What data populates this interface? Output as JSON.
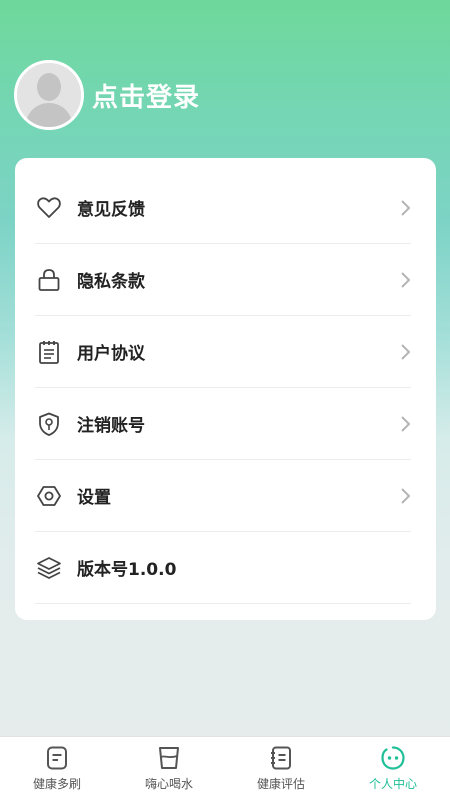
{
  "profile": {
    "login_text": "点击登录",
    "avatar_icon": "default-user-avatar"
  },
  "menu": [
    {
      "label": "意见反馈",
      "icon": "heart-icon",
      "has_arrow": true
    },
    {
      "label": "隐私条款",
      "icon": "lock-icon",
      "has_arrow": true
    },
    {
      "label": "用户协议",
      "icon": "notepad-icon",
      "has_arrow": true
    },
    {
      "label": "注销账号",
      "icon": "shield-key-icon",
      "has_arrow": true
    },
    {
      "label": "设置",
      "icon": "hexagon-settings-icon",
      "has_arrow": true
    },
    {
      "label": "版本号1.0.0",
      "icon": "layers-icon",
      "has_arrow": false
    }
  ],
  "tabs": [
    {
      "label": "健康多刷",
      "icon": "document-icon",
      "active": false
    },
    {
      "label": "嗨心喝水",
      "icon": "cup-icon",
      "active": false
    },
    {
      "label": "健康评估",
      "icon": "notebook-icon",
      "active": false
    },
    {
      "label": "个人中心",
      "icon": "smiley-icon",
      "active": true
    }
  ],
  "colors": {
    "accent": "#1fbf97",
    "header_green": "#6ed89a",
    "text_dark": "#222222",
    "icon_gray": "#555555"
  }
}
